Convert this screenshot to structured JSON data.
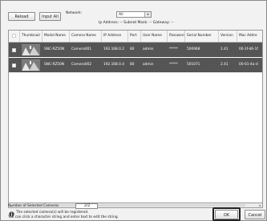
{
  "toolbar": {
    "reload_label": "Reload",
    "input_all_label": "Input All",
    "network_label": "Network:",
    "network_value": "All",
    "ip_info": "Ip Address: -- Subnet Mask: -- Gateway: --"
  },
  "table": {
    "columns": [
      "Thumbnail",
      "Model Name",
      "Camera Name",
      "IP Address",
      "Port",
      "User Name",
      "Password",
      "Serial Number",
      "Version",
      "Mac Addre"
    ],
    "rows": [
      {
        "model": "SNC-RZ50N",
        "camera": "Camera001",
        "ip": "192.168.0.2",
        "port": "80",
        "user": "admin",
        "password": "*****",
        "serial": "500968",
        "version": "2.41",
        "mac": "00-1f-d6-1f"
      },
      {
        "model": "SNC-RZ50N",
        "camera": "Camera002",
        "ip": "192.168.0.4",
        "port": "80",
        "user": "admin",
        "password": "*****",
        "serial": "501071",
        "version": "2.41",
        "mac": "00-01-4a-d"
      }
    ]
  },
  "footer": {
    "selected_label": "Number of Selected Cameras",
    "selected_value": "2/2",
    "info_line1": "The selected camera(s) will be registered.",
    "info_line2": "You can click a character string and enter text to edit the string.",
    "ok_label": "OK",
    "cancel_label": "Cancel",
    "info_icon": "info-icon"
  }
}
